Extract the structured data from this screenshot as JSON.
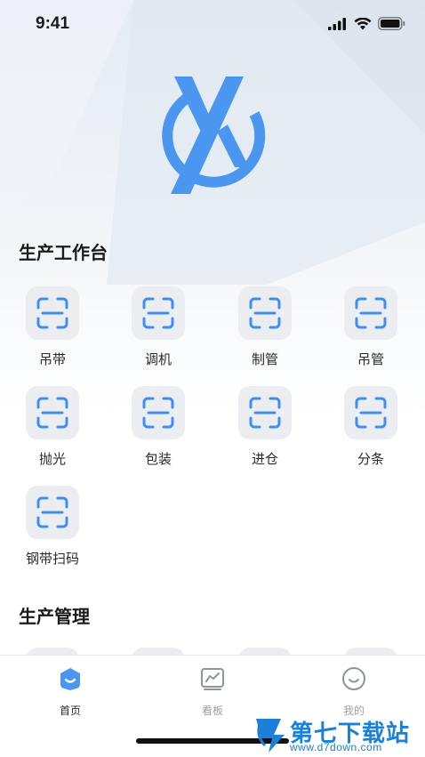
{
  "status_bar": {
    "time": "9:41"
  },
  "sections": [
    {
      "title": "生产工作台",
      "items": [
        {
          "label": "吊带",
          "icon": "scan-icon"
        },
        {
          "label": "调机",
          "icon": "scan-icon"
        },
        {
          "label": "制管",
          "icon": "scan-icon"
        },
        {
          "label": "吊管",
          "icon": "scan-icon"
        },
        {
          "label": "抛光",
          "icon": "scan-icon"
        },
        {
          "label": "包装",
          "icon": "scan-icon"
        },
        {
          "label": "进仓",
          "icon": "scan-icon"
        },
        {
          "label": "分条",
          "icon": "scan-icon"
        },
        {
          "label": "钢带扫码",
          "icon": "scan-icon"
        }
      ]
    },
    {
      "title": "生产管理"
    }
  ],
  "tab_bar": {
    "tabs": [
      {
        "label": "首页",
        "icon": "home-icon",
        "active": true
      },
      {
        "label": "看板",
        "icon": "chart-icon",
        "active": false
      },
      {
        "label": "我的",
        "icon": "smile-icon",
        "active": false
      }
    ]
  },
  "watermark": {
    "name": "第七下载站",
    "url": "www.d7down.com"
  },
  "colors": {
    "accent": "#4a96f0",
    "scan_icon": "#3f8ff2",
    "tile_bg": "#ebedf1"
  }
}
